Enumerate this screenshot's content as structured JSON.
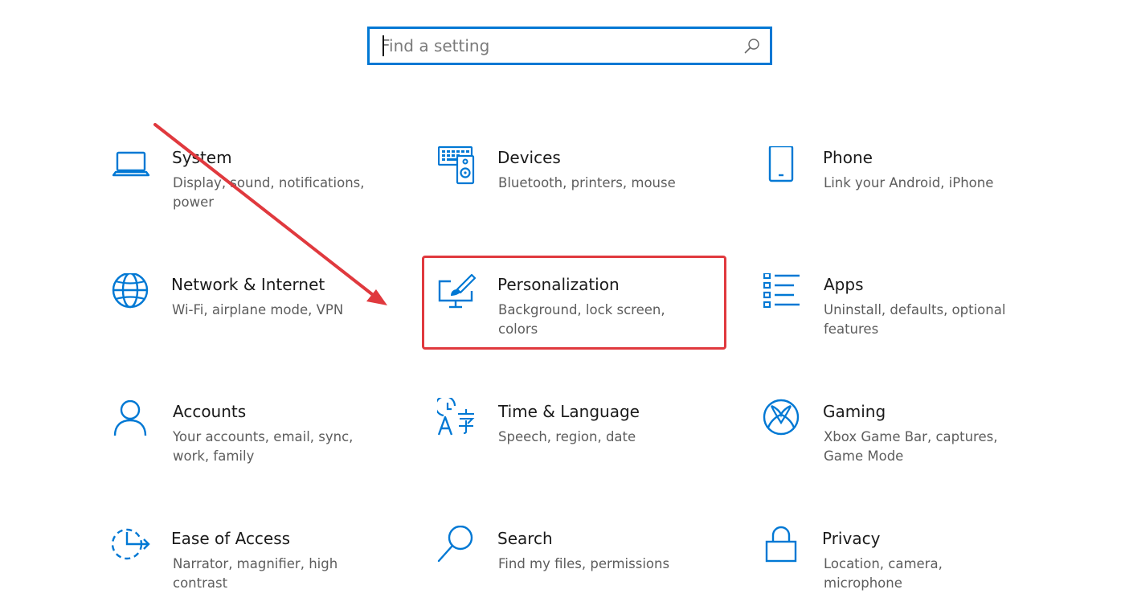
{
  "search": {
    "placeholder": "Find a setting"
  },
  "colors": {
    "accent": "#0078d4",
    "annotation": "#e0393e"
  },
  "tiles": [
    {
      "title": "System",
      "desc": "Display, sound, notifications, power",
      "icon": "laptop-icon"
    },
    {
      "title": "Devices",
      "desc": "Bluetooth, printers, mouse",
      "icon": "devices-icon"
    },
    {
      "title": "Phone",
      "desc": "Link your Android, iPhone",
      "icon": "phone-icon"
    },
    {
      "title": "Network & Internet",
      "desc": "Wi-Fi, airplane mode, VPN",
      "icon": "globe-icon"
    },
    {
      "title": "Personalization",
      "desc": "Background, lock screen, colors",
      "icon": "paintbrush-monitor-icon"
    },
    {
      "title": "Apps",
      "desc": "Uninstall, defaults, optional features",
      "icon": "apps-list-icon"
    },
    {
      "title": "Accounts",
      "desc": "Your accounts, email, sync, work, family",
      "icon": "person-icon"
    },
    {
      "title": "Time & Language",
      "desc": "Speech, region, date",
      "icon": "time-language-icon"
    },
    {
      "title": "Gaming",
      "desc": "Xbox Game Bar, captures, Game Mode",
      "icon": "xbox-icon"
    },
    {
      "title": "Ease of Access",
      "desc": "Narrator, magnifier, high contrast",
      "icon": "ease-of-access-icon"
    },
    {
      "title": "Search",
      "desc": "Find my files, permissions",
      "icon": "magnifier-icon"
    },
    {
      "title": "Privacy",
      "desc": "Location, camera, microphone",
      "icon": "lock-icon"
    }
  ]
}
